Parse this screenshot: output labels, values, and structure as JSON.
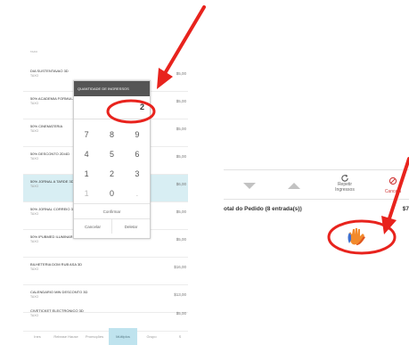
{
  "ticket_list": {
    "top_label": "TAXO",
    "rows": [
      {
        "title": "DIA SUSTENTAVAO 3D",
        "sub": "TAXO",
        "price": "$5,00"
      },
      {
        "title": "50% ACADEMIA FORMULA",
        "sub": "TAXO",
        "price": "$5,00"
      },
      {
        "title": "50% CINEMATERIA",
        "sub": "TAXO",
        "price": "$5,00"
      },
      {
        "title": "50% DESCONTO 2D/4D",
        "sub": "TAXO",
        "price": "$5,00"
      },
      {
        "title": "50% JORNAL A TARDE 3D",
        "sub": "TAXO",
        "price": "$6,00"
      },
      {
        "title": "50% JORNAL CORREIO 3D",
        "sub": "TAXO",
        "price": "$5,00"
      },
      {
        "title": "50% IPUBMED ILUMINAR",
        "sub": "TAXO",
        "price": "$5,00"
      },
      {
        "title": "BILHETERIA DOM RUB ASA 3D",
        "sub": "TAXO",
        "price": "$16,00"
      },
      {
        "title": "CALENDARIO MIN DESCONTO 3D",
        "sub": "TAXO",
        "price": "$13,00"
      },
      {
        "title": "CIVETICKET ELECTRONICO 3D",
        "sub": "TAXO",
        "price": "$5,00"
      }
    ],
    "tabs": [
      "Ines",
      "Release Hause",
      "Promoções",
      "Múltiplos",
      "Grupo",
      "S"
    ]
  },
  "quantity_modal": {
    "title": "QUANTIDADE DE INGRESSOS",
    "value": "2",
    "keys": [
      "7",
      "8",
      "9",
      "4",
      "5",
      "6",
      "1",
      "2",
      "3",
      "1",
      "0",
      "."
    ],
    "confirm": "Confirmar",
    "cancel": "Cancelar",
    "clear": "Deletar"
  },
  "order_bar": {
    "repeat_line1": "Repetir",
    "repeat_line2": "Ingressos",
    "cancel_label": "Cancela",
    "total_label": "otal do Pedido (8 entrada(s))",
    "total_value": "$7"
  },
  "colors": {
    "accent": "#bfe3ee",
    "selected_row": "#d8eef3",
    "annotation_red": "#e8231d",
    "modal_header": "#555555"
  }
}
